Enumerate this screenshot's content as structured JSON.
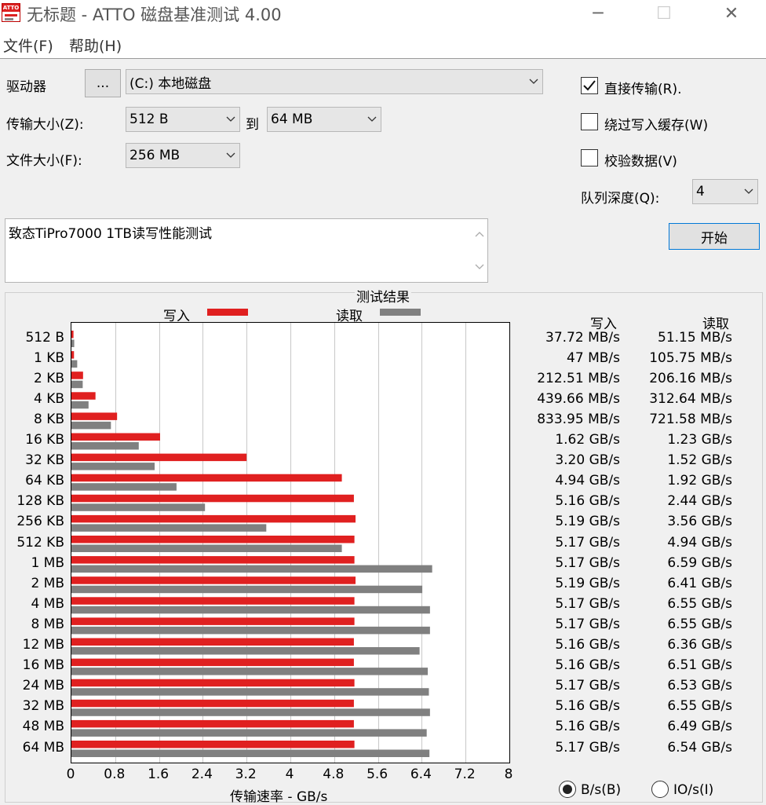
{
  "window": {
    "title": "无标题 - ATTO 磁盘基准测试 4.00",
    "icon_text": "ATTO",
    "controls": {
      "minimize": "─",
      "maximize": "☐",
      "close": "✕"
    }
  },
  "menu": {
    "file": "文件(F)",
    "help": "帮助(H)"
  },
  "settings": {
    "drive_label": "驱动器",
    "browse_button": "...",
    "drive_value": "(C:) 本地磁盘",
    "transfer_label": "传输大小(Z):",
    "transfer_from": "512 B",
    "to_label": "到",
    "transfer_to": "64 MB",
    "file_size_label": "文件大小(F):",
    "file_size": "256 MB",
    "direct_io_label": "直接传输(R).",
    "direct_io_checked": true,
    "bypass_cache_label": "绕过写入缓存(W)",
    "bypass_cache_checked": false,
    "verify_label": "校验数据(V)",
    "verify_checked": false,
    "queue_depth_label": "队列深度(Q):",
    "queue_depth": "4",
    "start_button": "开始",
    "description": "致态TiPro7000 1TB读写性能测试"
  },
  "results": {
    "title": "测试结果",
    "legend_write": "写入",
    "legend_read": "读取",
    "col_write": "写入",
    "col_read": "读取",
    "unit_bytes": "B/s(B)",
    "unit_io": "IO/s(I)",
    "unit_selected": "bytes"
  },
  "chart_data": {
    "type": "bar",
    "orientation": "horizontal",
    "title": "测试结果",
    "xlabel": "传输速率 - GB/s",
    "xlim": [
      0,
      8
    ],
    "xticks": [
      "0",
      "0.8",
      "1.6",
      "2.4",
      "3.2",
      "4",
      "4.8",
      "5.6",
      "6.4",
      "7.2",
      "8"
    ],
    "grid": true,
    "legend": "top",
    "categories": [
      "512 B",
      "1 KB",
      "2 KB",
      "4 KB",
      "8 KB",
      "16 KB",
      "32 KB",
      "64 KB",
      "128 KB",
      "256 KB",
      "512 KB",
      "1 MB",
      "2 MB",
      "4 MB",
      "8 MB",
      "12 MB",
      "16 MB",
      "24 MB",
      "32 MB",
      "48 MB",
      "64 MB"
    ],
    "series": [
      {
        "name": "写入",
        "color": "#e02020",
        "values": [
          0.03772,
          0.047,
          0.21251,
          0.43966,
          0.83395,
          1.62,
          3.2,
          4.94,
          5.16,
          5.19,
          5.17,
          5.17,
          5.19,
          5.17,
          5.17,
          5.16,
          5.16,
          5.17,
          5.16,
          5.16,
          5.17
        ],
        "labels": [
          "37.72 MB/s",
          "47 MB/s",
          "212.51 MB/s",
          "439.66 MB/s",
          "833.95 MB/s",
          "1.62 GB/s",
          "3.20 GB/s",
          "4.94 GB/s",
          "5.16 GB/s",
          "5.19 GB/s",
          "5.17 GB/s",
          "5.17 GB/s",
          "5.19 GB/s",
          "5.17 GB/s",
          "5.17 GB/s",
          "5.16 GB/s",
          "5.16 GB/s",
          "5.17 GB/s",
          "5.16 GB/s",
          "5.16 GB/s",
          "5.17 GB/s"
        ]
      },
      {
        "name": "读取",
        "color": "#808080",
        "values": [
          0.05115,
          0.10575,
          0.20616,
          0.31264,
          0.72158,
          1.23,
          1.52,
          1.92,
          2.44,
          3.56,
          4.94,
          6.59,
          6.41,
          6.55,
          6.55,
          6.36,
          6.51,
          6.53,
          6.55,
          6.49,
          6.54
        ],
        "labels": [
          "51.15 MB/s",
          "105.75 MB/s",
          "206.16 MB/s",
          "312.64 MB/s",
          "721.58 MB/s",
          "1.23 GB/s",
          "1.52 GB/s",
          "1.92 GB/s",
          "2.44 GB/s",
          "3.56 GB/s",
          "4.94 GB/s",
          "6.59 GB/s",
          "6.41 GB/s",
          "6.55 GB/s",
          "6.55 GB/s",
          "6.36 GB/s",
          "6.51 GB/s",
          "6.53 GB/s",
          "6.55 GB/s",
          "6.49 GB/s",
          "6.54 GB/s"
        ]
      }
    ]
  }
}
